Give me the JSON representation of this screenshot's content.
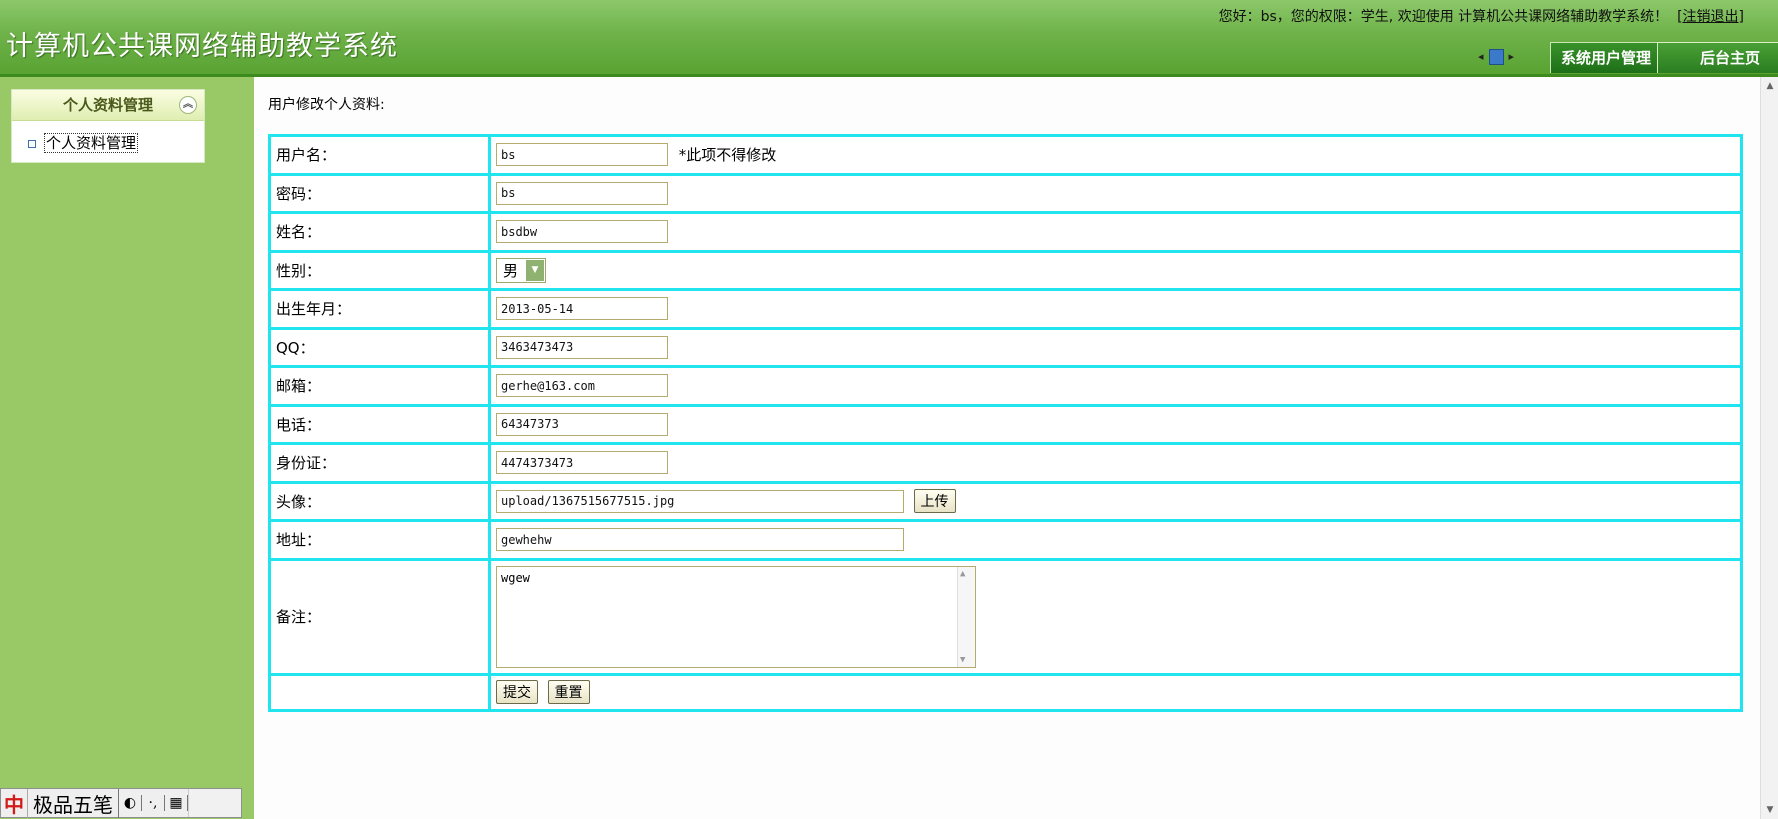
{
  "header": {
    "app_title": "计算机公共课网络辅助教学系统",
    "welcome_text": "您好：bs，您的权限：学生, 欢迎使用 计算机公共课网络辅助教学系统！",
    "logout_label": "[注销退出]",
    "nav_left": "◂",
    "nav_right": "▸",
    "user_mgmt_label": "系统用户管理",
    "home_label": "后台主页"
  },
  "sidebar": {
    "panel_title": "个人资料管理",
    "collapse_glyph": "︽",
    "items": [
      {
        "label": "个人资料管理"
      }
    ]
  },
  "main": {
    "caption": "用户修改个人资料:",
    "form": {
      "username": {
        "label": "用户名：",
        "value": "bs",
        "note": "*此项不得修改"
      },
      "password": {
        "label": "密码：",
        "value": "bs"
      },
      "name": {
        "label": "姓名：",
        "value": "bsdbw"
      },
      "gender": {
        "label": "性别：",
        "value": "男",
        "arrow": "▼"
      },
      "birth": {
        "label": "出生年月：",
        "value": "2013-05-14"
      },
      "qq": {
        "label": "QQ：",
        "value": "3463473473"
      },
      "email": {
        "label": "邮箱：",
        "value": "gerhe@163.com"
      },
      "phone": {
        "label": "电话：",
        "value": "64347373"
      },
      "idcard": {
        "label": "身份证：",
        "value": "4474373473"
      },
      "avatar": {
        "label": "头像：",
        "value": "upload/1367515677515.jpg",
        "upload_label": "上传"
      },
      "address": {
        "label": "地址：",
        "value": "gewhehw"
      },
      "remark": {
        "label": "备注：",
        "value": "wgew"
      },
      "submit_label": "提交",
      "reset_label": "重置"
    }
  },
  "ime": {
    "zh": "中",
    "name": "极品五笔",
    "c1": "◐",
    "c2": "·,",
    "c3": "▦"
  }
}
